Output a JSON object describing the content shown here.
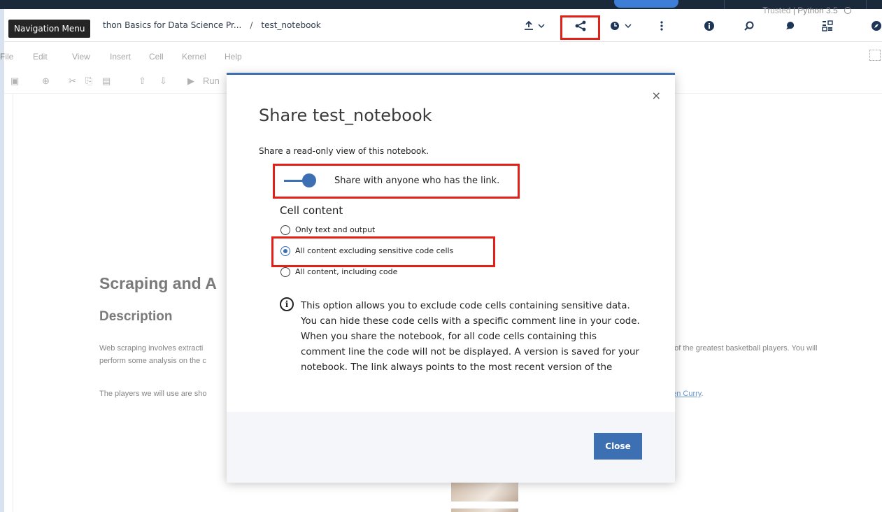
{
  "tooltip": {
    "text": "Navigation Menu"
  },
  "breadcrumb": {
    "project": "thon Basics for Data Science Pr...",
    "separator": "/",
    "notebook": "test_notebook"
  },
  "menu": {
    "items": [
      "File",
      "Edit",
      "View",
      "Insert",
      "Cell",
      "Kernel",
      "Help"
    ]
  },
  "kernel_status": {
    "trusted": "Trusted",
    "divider": "|",
    "kernel": "Python 3.5"
  },
  "toolbar": {
    "run_label": "Run"
  },
  "notebook": {
    "title": "Scraping and A",
    "section": "Description",
    "para1_start": "Web scraping involves extracti",
    "para1_line2": "perform some analysis on the c",
    "para1_end": "e of the greatest basketball players. You will",
    "para2_start": "The players we will use are sho",
    "para2_link": "hen Curry",
    "para2_end": "."
  },
  "modal": {
    "title": "Share test_notebook",
    "subtitle": "Share a read-only view of this notebook.",
    "toggle_label": "Share with anyone who has the link.",
    "toggle_on": true,
    "cell_content_heading": "Cell content",
    "options": [
      {
        "label": "Only text and output",
        "selected": false
      },
      {
        "label": "All content excluding sensitive code cells",
        "selected": true
      },
      {
        "label": "All content, including code",
        "selected": false
      }
    ],
    "info": "This option allows you to exclude code cells containing sensitive data. You can hide these code cells with a specific comment line in your code. When you share the notebook, for all code cells containing this comment line the code will not be displayed. A version is saved for your notebook. The link always points to the most recent version of the",
    "close_button": "Close",
    "close_x": "×"
  },
  "icons": {
    "upload": "upload-icon",
    "share": "share-icon",
    "schedule": "clock-icon",
    "more": "more-vertical-icon",
    "info": "info-icon",
    "find": "find-resources-icon",
    "comments": "comments-icon",
    "data": "data-icon",
    "compass": "compass-icon"
  },
  "colors": {
    "accent": "#3d70b2",
    "highlight": "#e32018",
    "topbar": "#1b2a3b"
  }
}
